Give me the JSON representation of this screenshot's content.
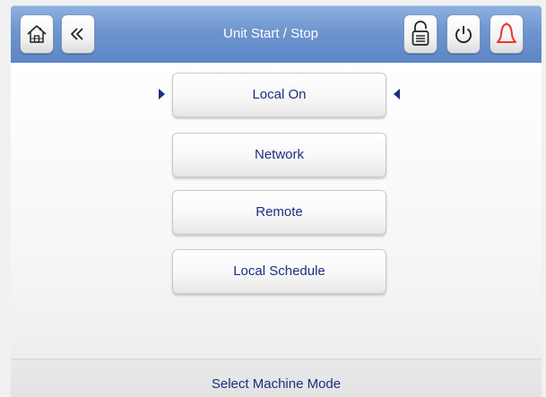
{
  "header": {
    "title": "Unit Start / Stop",
    "left_buttons": [
      {
        "icon": "home-icon"
      },
      {
        "icon": "back-chevron-icon"
      }
    ],
    "right_buttons": [
      {
        "icon": "login-lock-icon"
      },
      {
        "icon": "power-icon"
      },
      {
        "icon": "alarm-bell-icon",
        "color": "#e53a2b"
      }
    ]
  },
  "modes": {
    "selected": "Local On",
    "items": [
      "Local On",
      "Network",
      "Remote",
      "Local Schedule"
    ]
  },
  "footer": {
    "status": "Select Machine Mode"
  },
  "colors": {
    "header_gradient_top": "#8fb2e1",
    "header_gradient_bottom": "#5c86c6",
    "text_accent": "#1c2f80",
    "alarm": "#e53a2b"
  }
}
